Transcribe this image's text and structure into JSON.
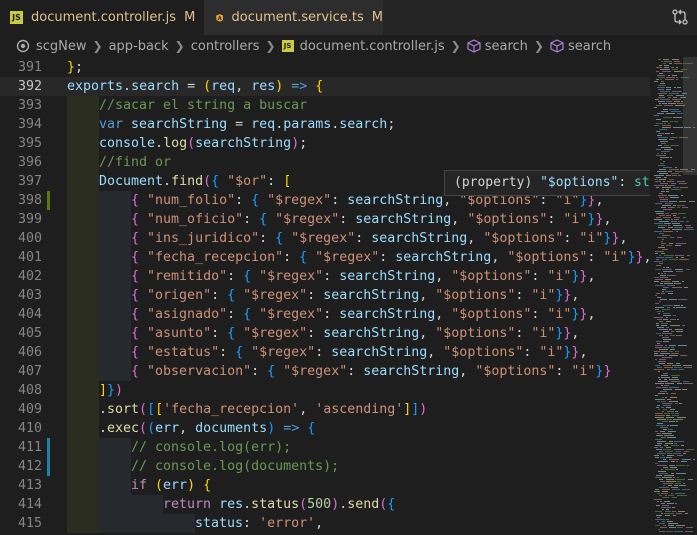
{
  "tabs": [
    {
      "badge": "JS",
      "label": "document.controller.js",
      "status": "M",
      "active": true
    },
    {
      "badge": "A",
      "label": "document.service.ts",
      "status": "M",
      "active": false
    }
  ],
  "breadcrumb": [
    {
      "text": "scgNew",
      "icon": "source-control-icon"
    },
    {
      "text": "app-back"
    },
    {
      "text": "controllers"
    },
    {
      "text": "document.controller.js",
      "icon": "js-file-icon"
    },
    {
      "text": "search",
      "icon": "method-icon"
    },
    {
      "text": "search",
      "icon": "method-icon"
    }
  ],
  "tooltip": {
    "prefix": "(property) ",
    "name": "\"$options\"",
    "sep": ": ",
    "type": "string"
  },
  "current_line": "392",
  "lines": [
    {
      "n": "391",
      "indent": 0,
      "tokens": [
        [
          "}",
          "br1"
        ],
        [
          ";",
          "pun"
        ]
      ]
    },
    {
      "n": "392",
      "indent": 0,
      "tokens": [
        [
          "exports",
          "var"
        ],
        [
          ".",
          "pun"
        ],
        [
          "search",
          "var"
        ],
        [
          " = ",
          "pun"
        ],
        [
          "(",
          "br1"
        ],
        [
          "req",
          "var"
        ],
        [
          ", ",
          "pun"
        ],
        [
          "res",
          "var"
        ],
        [
          ")",
          "br1"
        ],
        [
          " ",
          "pun"
        ],
        [
          "=>",
          "kw"
        ],
        [
          " ",
          "pun"
        ],
        [
          "{",
          "br1"
        ]
      ]
    },
    {
      "n": "393",
      "indent": 1,
      "tokens": [
        [
          "//sacar el string a buscar",
          "cmt"
        ]
      ]
    },
    {
      "n": "394",
      "indent": 1,
      "tokens": [
        [
          "var",
          "kw"
        ],
        [
          " ",
          "pun"
        ],
        [
          "searchString",
          "var"
        ],
        [
          " = ",
          "pun"
        ],
        [
          "req",
          "var"
        ],
        [
          ".",
          "pun"
        ],
        [
          "params",
          "var"
        ],
        [
          ".",
          "pun"
        ],
        [
          "search",
          "var"
        ],
        [
          ";",
          "pun"
        ]
      ]
    },
    {
      "n": "395",
      "indent": 1,
      "tokens": [
        [
          "console",
          "var"
        ],
        [
          ".",
          "pun"
        ],
        [
          "log",
          "fn"
        ],
        [
          "(",
          "br2"
        ],
        [
          "searchString",
          "var"
        ],
        [
          ")",
          "br2"
        ],
        [
          ";",
          "pun"
        ]
      ]
    },
    {
      "n": "396",
      "indent": 1,
      "tokens": [
        [
          "//find or",
          "cmt"
        ]
      ]
    },
    {
      "n": "397",
      "indent": 1,
      "tokens": [
        [
          "Document",
          "var"
        ],
        [
          ".",
          "pun"
        ],
        [
          "find",
          "fn"
        ],
        [
          "(",
          "br2"
        ],
        [
          "{",
          "br3"
        ],
        [
          " ",
          "pun"
        ],
        [
          "\"$or\"",
          "str"
        ],
        [
          ": ",
          "pun"
        ],
        [
          "[",
          "br1"
        ]
      ]
    },
    {
      "n": "398",
      "indent": 2,
      "tokens": [
        [
          "{",
          "br2"
        ],
        [
          " ",
          "pun"
        ],
        [
          "\"num_folio\"",
          "str"
        ],
        [
          ": ",
          "pun"
        ],
        [
          "{",
          "br3"
        ],
        [
          " ",
          "pun"
        ],
        [
          "\"$regex\"",
          "str"
        ],
        [
          ": ",
          "pun"
        ],
        [
          "searchString",
          "var"
        ],
        [
          ", ",
          "pun"
        ],
        [
          "\"$options\"",
          "str"
        ],
        [
          ": ",
          "pun"
        ],
        [
          "\"i\"",
          "str"
        ],
        [
          "}",
          "br3"
        ],
        [
          "}",
          "br2"
        ],
        [
          ",",
          "pun"
        ]
      ]
    },
    {
      "n": "399",
      "indent": 2,
      "tokens": [
        [
          "{",
          "br2"
        ],
        [
          " ",
          "pun"
        ],
        [
          "\"num_oficio\"",
          "str"
        ],
        [
          ": ",
          "pun"
        ],
        [
          "{",
          "br3"
        ],
        [
          " ",
          "pun"
        ],
        [
          "\"$regex\"",
          "str"
        ],
        [
          ": ",
          "pun"
        ],
        [
          "searchString",
          "var"
        ],
        [
          ", ",
          "pun"
        ],
        [
          "\"$options\"",
          "str"
        ],
        [
          ": ",
          "pun"
        ],
        [
          "\"i\"",
          "str"
        ],
        [
          "}",
          "br3"
        ],
        [
          "}",
          "br2"
        ],
        [
          ",",
          "pun"
        ]
      ]
    },
    {
      "n": "400",
      "indent": 2,
      "tokens": [
        [
          "{",
          "br2"
        ],
        [
          " ",
          "pun"
        ],
        [
          "\"ins_juridico\"",
          "str"
        ],
        [
          ": ",
          "pun"
        ],
        [
          "{",
          "br3"
        ],
        [
          " ",
          "pun"
        ],
        [
          "\"$regex\"",
          "str"
        ],
        [
          ": ",
          "pun"
        ],
        [
          "searchString",
          "var"
        ],
        [
          ", ",
          "pun"
        ],
        [
          "\"$options\"",
          "str"
        ],
        [
          ": ",
          "pun"
        ],
        [
          "\"i\"",
          "str"
        ],
        [
          "}",
          "br3"
        ],
        [
          "}",
          "br2"
        ],
        [
          ",",
          "pun"
        ]
      ]
    },
    {
      "n": "401",
      "indent": 2,
      "tokens": [
        [
          "{",
          "br2"
        ],
        [
          " ",
          "pun"
        ],
        [
          "\"fecha_recepcion\"",
          "str"
        ],
        [
          ": ",
          "pun"
        ],
        [
          "{",
          "br3"
        ],
        [
          " ",
          "pun"
        ],
        [
          "\"$regex\"",
          "str"
        ],
        [
          ": ",
          "pun"
        ],
        [
          "searchString",
          "var"
        ],
        [
          ", ",
          "pun"
        ],
        [
          "\"$options\"",
          "str"
        ],
        [
          ": ",
          "pun"
        ],
        [
          "\"i\"",
          "str"
        ],
        [
          "}",
          "br3"
        ],
        [
          "}",
          "br2"
        ],
        [
          ",",
          "pun"
        ]
      ]
    },
    {
      "n": "402",
      "indent": 2,
      "tokens": [
        [
          "{",
          "br2"
        ],
        [
          " ",
          "pun"
        ],
        [
          "\"remitido\"",
          "str"
        ],
        [
          ": ",
          "pun"
        ],
        [
          "{",
          "br3"
        ],
        [
          " ",
          "pun"
        ],
        [
          "\"$regex\"",
          "str"
        ],
        [
          ": ",
          "pun"
        ],
        [
          "searchString",
          "var"
        ],
        [
          ", ",
          "pun"
        ],
        [
          "\"$options\"",
          "str"
        ],
        [
          ": ",
          "pun"
        ],
        [
          "\"i\"",
          "str"
        ],
        [
          "}",
          "br3"
        ],
        [
          "}",
          "br2"
        ],
        [
          ",",
          "pun"
        ]
      ]
    },
    {
      "n": "403",
      "indent": 2,
      "tokens": [
        [
          "{",
          "br2"
        ],
        [
          " ",
          "pun"
        ],
        [
          "\"origen\"",
          "str"
        ],
        [
          ": ",
          "pun"
        ],
        [
          "{",
          "br3"
        ],
        [
          " ",
          "pun"
        ],
        [
          "\"$regex\"",
          "str"
        ],
        [
          ": ",
          "pun"
        ],
        [
          "searchString",
          "var"
        ],
        [
          ", ",
          "pun"
        ],
        [
          "\"$options\"",
          "str"
        ],
        [
          ": ",
          "pun"
        ],
        [
          "\"i\"",
          "str"
        ],
        [
          "}",
          "br3"
        ],
        [
          "}",
          "br2"
        ],
        [
          ",",
          "pun"
        ]
      ]
    },
    {
      "n": "404",
      "indent": 2,
      "tokens": [
        [
          "{",
          "br2"
        ],
        [
          " ",
          "pun"
        ],
        [
          "\"asignado\"",
          "str"
        ],
        [
          ": ",
          "pun"
        ],
        [
          "{",
          "br3"
        ],
        [
          " ",
          "pun"
        ],
        [
          "\"$regex\"",
          "str"
        ],
        [
          ": ",
          "pun"
        ],
        [
          "searchString",
          "var"
        ],
        [
          ", ",
          "pun"
        ],
        [
          "\"$options\"",
          "str"
        ],
        [
          ": ",
          "pun"
        ],
        [
          "\"i\"",
          "str"
        ],
        [
          "}",
          "br3"
        ],
        [
          "}",
          "br2"
        ],
        [
          ",",
          "pun"
        ]
      ]
    },
    {
      "n": "405",
      "indent": 2,
      "tokens": [
        [
          "{",
          "br2"
        ],
        [
          " ",
          "pun"
        ],
        [
          "\"asunto\"",
          "str"
        ],
        [
          ": ",
          "pun"
        ],
        [
          "{",
          "br3"
        ],
        [
          " ",
          "pun"
        ],
        [
          "\"$regex\"",
          "str"
        ],
        [
          ": ",
          "pun"
        ],
        [
          "searchString",
          "var"
        ],
        [
          ", ",
          "pun"
        ],
        [
          "\"$options\"",
          "str"
        ],
        [
          ": ",
          "pun"
        ],
        [
          "\"i\"",
          "str"
        ],
        [
          "}",
          "br3"
        ],
        [
          "}",
          "br2"
        ],
        [
          ",",
          "pun"
        ]
      ]
    },
    {
      "n": "406",
      "indent": 2,
      "tokens": [
        [
          "{",
          "br2"
        ],
        [
          " ",
          "pun"
        ],
        [
          "\"estatus\"",
          "str"
        ],
        [
          ": ",
          "pun"
        ],
        [
          "{",
          "br3"
        ],
        [
          " ",
          "pun"
        ],
        [
          "\"$regex\"",
          "str"
        ],
        [
          ": ",
          "pun"
        ],
        [
          "searchString",
          "var"
        ],
        [
          ", ",
          "pun"
        ],
        [
          "\"$options\"",
          "str"
        ],
        [
          ": ",
          "pun"
        ],
        [
          "\"i\"",
          "str"
        ],
        [
          "}",
          "br3"
        ],
        [
          "}",
          "br2"
        ],
        [
          ",",
          "pun"
        ]
      ]
    },
    {
      "n": "407",
      "indent": 2,
      "tokens": [
        [
          "{",
          "br2"
        ],
        [
          " ",
          "pun"
        ],
        [
          "\"observacion\"",
          "str"
        ],
        [
          ": ",
          "pun"
        ],
        [
          "{",
          "br3"
        ],
        [
          " ",
          "pun"
        ],
        [
          "\"$regex\"",
          "str"
        ],
        [
          ": ",
          "pun"
        ],
        [
          "searchString",
          "var"
        ],
        [
          ", ",
          "pun"
        ],
        [
          "\"$options\"",
          "str"
        ],
        [
          ": ",
          "pun"
        ],
        [
          "\"i\"",
          "str"
        ],
        [
          "}",
          "br3"
        ],
        [
          "}",
          "br2"
        ]
      ]
    },
    {
      "n": "408",
      "indent": 1,
      "tokens": [
        [
          "]",
          "br1"
        ],
        [
          "}",
          "br3"
        ],
        [
          ")",
          "br2"
        ]
      ]
    },
    {
      "n": "409",
      "indent": 1,
      "tokens": [
        [
          ".",
          "pun"
        ],
        [
          "sort",
          "fn"
        ],
        [
          "(",
          "br2"
        ],
        [
          "[",
          "br3"
        ],
        [
          "[",
          "br1"
        ],
        [
          "'fecha_recepcion'",
          "str"
        ],
        [
          ", ",
          "pun"
        ],
        [
          "'ascending'",
          "str"
        ],
        [
          "]",
          "br1"
        ],
        [
          "]",
          "br3"
        ],
        [
          ")",
          "br2"
        ]
      ]
    },
    {
      "n": "410",
      "indent": 1,
      "tokens": [
        [
          ".",
          "pun"
        ],
        [
          "exec",
          "fn"
        ],
        [
          "(",
          "br2"
        ],
        [
          "(",
          "br3"
        ],
        [
          "err",
          "var"
        ],
        [
          ", ",
          "pun"
        ],
        [
          "documents",
          "var"
        ],
        [
          ")",
          "br3"
        ],
        [
          " ",
          "pun"
        ],
        [
          "=>",
          "kw"
        ],
        [
          " ",
          "pun"
        ],
        [
          "{",
          "br3"
        ]
      ]
    },
    {
      "n": "411",
      "indent": 2,
      "tokens": [
        [
          "// console.log(err);",
          "cmt"
        ]
      ]
    },
    {
      "n": "412",
      "indent": 2,
      "tokens": [
        [
          "// console.log(documents);",
          "cmt"
        ]
      ]
    },
    {
      "n": "413",
      "indent": 2,
      "tokens": [
        [
          "if",
          "ctl"
        ],
        [
          " ",
          "pun"
        ],
        [
          "(",
          "br1"
        ],
        [
          "err",
          "var"
        ],
        [
          ")",
          "br1"
        ],
        [
          " ",
          "pun"
        ],
        [
          "{",
          "br1"
        ]
      ]
    },
    {
      "n": "414",
      "indent": 3,
      "tokens": [
        [
          "return",
          "ctl"
        ],
        [
          " ",
          "pun"
        ],
        [
          "res",
          "var"
        ],
        [
          ".",
          "pun"
        ],
        [
          "status",
          "fn"
        ],
        [
          "(",
          "br2"
        ],
        [
          "500",
          "num"
        ],
        [
          ")",
          "br2"
        ],
        [
          ".",
          "pun"
        ],
        [
          "send",
          "fn"
        ],
        [
          "(",
          "br2"
        ],
        [
          "{",
          "br3"
        ]
      ]
    },
    {
      "n": "415",
      "indent": 4,
      "tokens": [
        [
          "status",
          "var"
        ],
        [
          ": ",
          "pun"
        ],
        [
          "'error'",
          "str"
        ],
        [
          ",",
          "pun"
        ]
      ]
    }
  ],
  "gutter_marks": {
    "398": "#587c0c",
    "411": "#1b81a8",
    "412": "#1b81a8"
  },
  "colors": {
    "modified": "#e2c08d",
    "indent_band_1": "#2a2d1f",
    "indent_band_2": "#262a2e"
  }
}
